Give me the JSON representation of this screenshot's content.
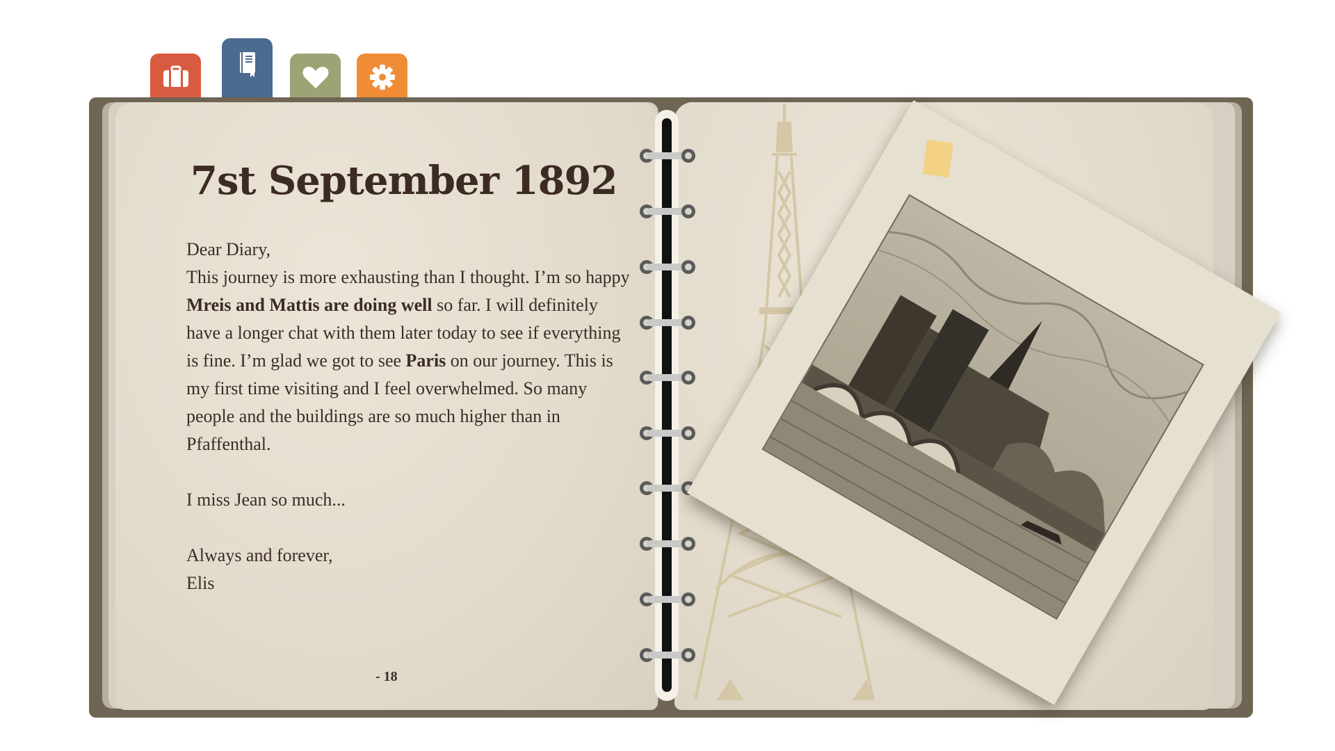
{
  "tabs": [
    {
      "label": "travel",
      "icon": "suitcase-icon",
      "color": "#d85a40"
    },
    {
      "label": "diary",
      "icon": "notebook-icon",
      "color": "#4b6b8f"
    },
    {
      "label": "favorites",
      "icon": "heart-icon",
      "color": "#9ba474"
    },
    {
      "label": "settings",
      "icon": "gear-icon",
      "color": "#f08c35"
    }
  ],
  "diary": {
    "title": "7st September 1892",
    "greeting": "Dear Diary,",
    "body": {
      "p1": "This journey is more exhausting than I thought. I’m so happy ",
      "b1": "Mreis and Mattis are doing well",
      "p2": " so far. I will definitely have a longer chat with them later today to see if everything is fine. I’m glad we got to see ",
      "b2": "Paris",
      "p3": " on our journey. This is my first time visiting and I feel overwhelmed. So many people and the buildings are so much higher than in Pfaffenthal."
    },
    "miss": "I miss Jean so much...",
    "closing": "Always and forever,",
    "signature": "Elis",
    "page_number": "- 18"
  },
  "colors": {
    "cover": "#6e6555",
    "paper": "#e3dccd",
    "ink": "#3a2c24",
    "tower": "#cfc3a2"
  }
}
